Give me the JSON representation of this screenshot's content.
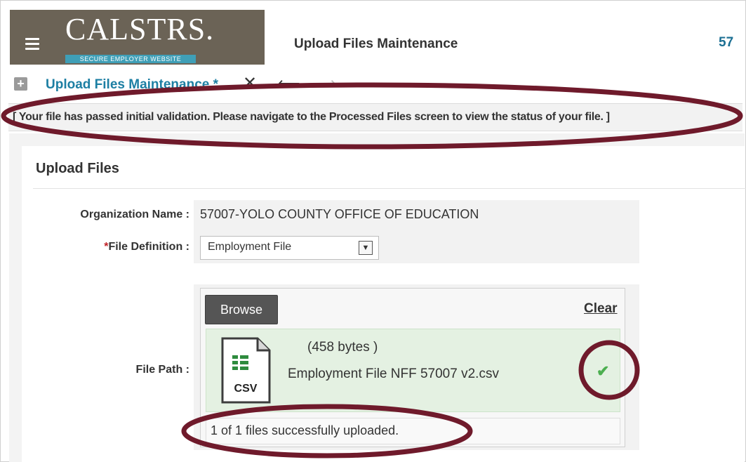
{
  "header": {
    "logo_text": "CALSTRS.",
    "logo_subtitle": "SECURE EMPLOYER WEBSITE",
    "title": "Upload Files Maintenance",
    "org_code": "57"
  },
  "tab": {
    "label": "Upload Files Maintenance *"
  },
  "message": "[ Your file has passed initial validation. Please navigate to the Processed Files screen to view the status of your file. ]",
  "panel": {
    "title": "Upload Files"
  },
  "form": {
    "org_label": "Organization Name :",
    "org_value": "57007-YOLO COUNTY OFFICE OF EDUCATION",
    "file_def_required": "*",
    "file_def_label": "File Definition :",
    "file_def_value": "Employment File",
    "file_path_label": "File Path :"
  },
  "upload": {
    "browse_label": "Browse",
    "clear_label": "Clear",
    "file_size": "(458 bytes )",
    "file_name": "Employment File NFF 57007 v2.csv",
    "file_icon_label": "CSV",
    "status": "1 of 1 files successfully uploaded."
  },
  "colors": {
    "accent": "#1d7fa3",
    "annotation": "#6f1a2b",
    "success": "#4caf50"
  }
}
